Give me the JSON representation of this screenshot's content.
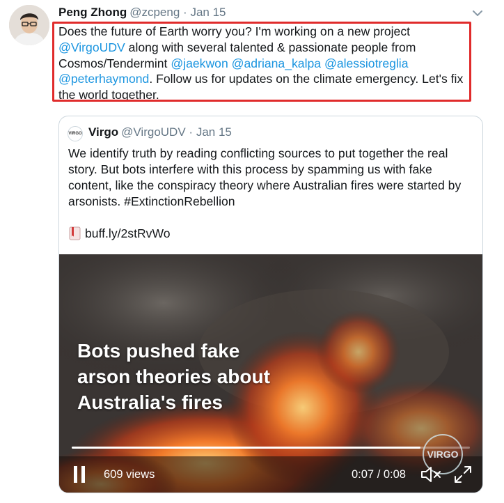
{
  "tweet": {
    "author_name": "Peng Zhong",
    "author_handle": "@zcpeng",
    "separator": "·",
    "date": "Jan 15",
    "text": [
      {
        "t": "Does the future of Earth worry you? I'm working on a new project ",
        "mention": false
      },
      {
        "t": "@VirgoUDV",
        "mention": true
      },
      {
        "t": " along with several talented & passionate people from Cosmos/Tendermint ",
        "mention": false
      },
      {
        "t": "@jaekwon",
        "mention": true
      },
      {
        "t": " ",
        "mention": false
      },
      {
        "t": "@adriana_kalpa",
        "mention": true
      },
      {
        "t": " ",
        "mention": false
      },
      {
        "t": "@alessiotreglia",
        "mention": true
      },
      {
        "t": " ",
        "mention": false
      },
      {
        "t": "@peterhaymond",
        "mention": true
      },
      {
        "t": ". Follow us for updates on the climate emergency. Let's fix the world together.",
        "mention": false
      }
    ],
    "highlight_color": "#e02b2b",
    "mention_color": "#1b95e0"
  },
  "quoted_tweet": {
    "logo_text": "VIRGO",
    "author_name": "Virgo",
    "author_handle": "@VirgoUDV",
    "separator": "·",
    "date": "Jan 15",
    "text": "We identify truth by reading conflicting sources to put together the real story. But bots interfere with this process by spamming us with fake content, like the conspiracy theory where Australian fires were started by arsonists. #ExtinctionRebellion",
    "link_icon": "bookmark-book-icon",
    "link_text": "buff.ly/2stRvWo"
  },
  "video": {
    "overlay_text": "Bots pushed fake\narson theories about\nAustralia's fires",
    "badge_text": "VIRGO",
    "views": "609 views",
    "time": "0:07 / 0:08",
    "progress": 0.875,
    "icons": [
      "pause-icon",
      "mute-icon",
      "expand-icon"
    ]
  }
}
